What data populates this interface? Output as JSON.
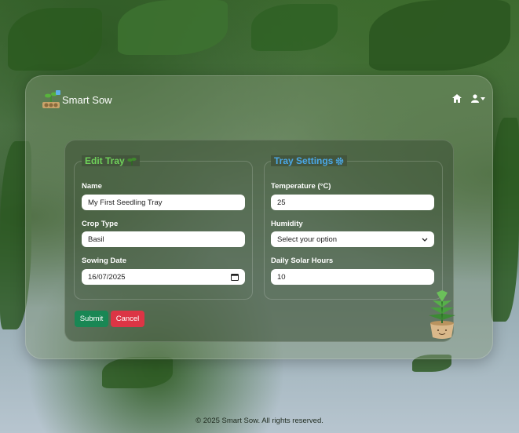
{
  "nav": {
    "brand": "Smart Sow",
    "home_icon": "home-icon",
    "user_icon": "user-icon"
  },
  "edit_tray": {
    "legend": "Edit Tray",
    "legend_icon": "seedling-icon",
    "name_label": "Name",
    "name_value": "My First Seedling Tray",
    "crop_label": "Crop Type",
    "crop_value": "Basil",
    "sowing_label": "Sowing Date",
    "sowing_value": "16/07/2025"
  },
  "tray_settings": {
    "legend": "Tray Settings",
    "legend_icon": "gear-icon",
    "temperature_label": "Temperature (°C)",
    "temperature_value": "25",
    "humidity_label": "Humidity",
    "humidity_value": "Select your option",
    "solar_label": "Daily Solar Hours",
    "solar_value": "10"
  },
  "actions": {
    "submit": "Submit",
    "cancel": "Cancel"
  },
  "colors": {
    "submit": "#198754",
    "cancel": "#dc3545",
    "legend_green": "#6fd15a",
    "legend_blue": "#4aa8e8"
  },
  "footer": {
    "text": "© 2025 Smart Sow. All rights reserved."
  }
}
